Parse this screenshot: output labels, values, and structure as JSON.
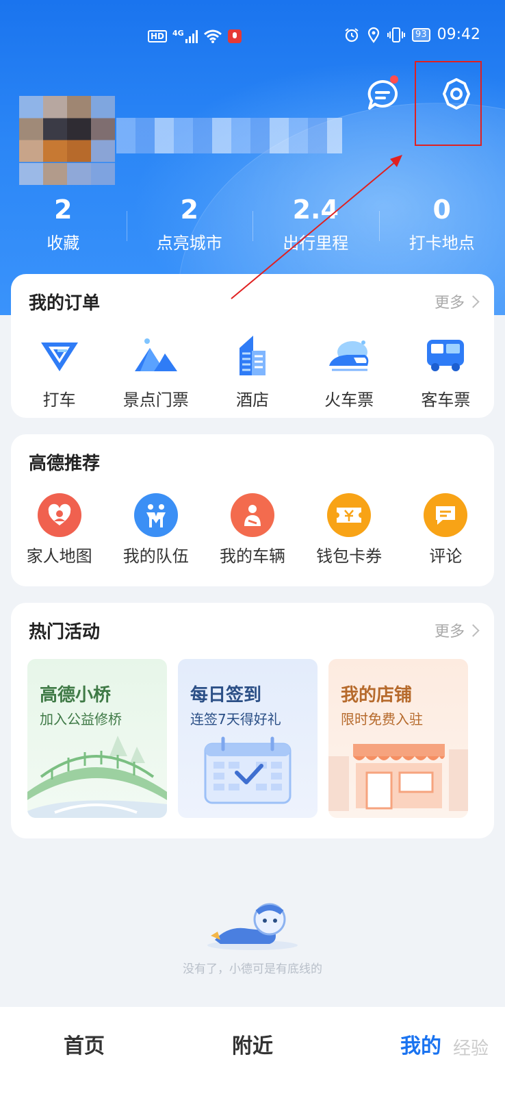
{
  "status_bar": {
    "network": "4G",
    "hd": "HD",
    "battery": "93",
    "time": "09:42"
  },
  "stats": [
    {
      "value": "2",
      "label": "收藏"
    },
    {
      "value": "2",
      "label": "点亮城市"
    },
    {
      "value": "2.4",
      "label": "出行里程"
    },
    {
      "value": "0",
      "label": "打卡地点"
    }
  ],
  "orders": {
    "title": "我的订单",
    "more": "更多",
    "items": [
      {
        "label": "打车",
        "icon": "taxi-icon"
      },
      {
        "label": "景点门票",
        "icon": "mountain-ticket-icon"
      },
      {
        "label": "酒店",
        "icon": "hotel-building-icon"
      },
      {
        "label": "火车票",
        "icon": "train-icon"
      },
      {
        "label": "客车票",
        "icon": "bus-icon"
      }
    ]
  },
  "recommend": {
    "title": "高德推荐",
    "items": [
      {
        "label": "家人地图",
        "icon": "family-heart-icon",
        "color": "#f0614f"
      },
      {
        "label": "我的队伍",
        "icon": "team-icon",
        "color": "#3b8ff5"
      },
      {
        "label": "我的车辆",
        "icon": "vehicle-icon",
        "color": "#f36b4e"
      },
      {
        "label": "钱包卡券",
        "icon": "ticket-icon",
        "color": "#f8a316"
      },
      {
        "label": "评论",
        "icon": "comment-icon",
        "color": "#f8a316"
      }
    ]
  },
  "activities": {
    "title": "热门活动",
    "more": "更多",
    "items": [
      {
        "title": "高德小桥",
        "subtitle": "加入公益修桥",
        "color": "#3f7a46"
      },
      {
        "title": "每日签到",
        "subtitle": "连签7天得好礼",
        "color": "#2b4f86"
      },
      {
        "title": "我的店铺",
        "subtitle": "限时免费入驻",
        "color": "#b66a2c"
      }
    ]
  },
  "empty_text": "没有了，小德可是有底线的",
  "tabs": [
    {
      "label": "首页"
    },
    {
      "label": "附近"
    },
    {
      "label": "我的"
    }
  ],
  "watermark": "经验"
}
